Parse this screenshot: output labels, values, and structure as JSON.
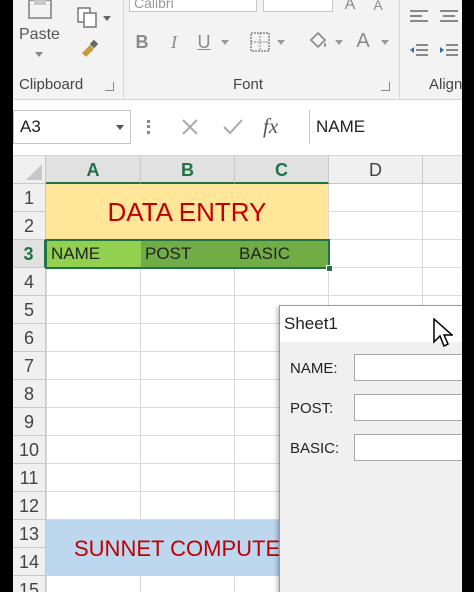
{
  "ribbon": {
    "clipboard": {
      "paste_label": "Paste",
      "group_label": "Clipboard"
    },
    "font": {
      "font_name": "Calibri",
      "group_label": "Font",
      "bold": "B",
      "italic": "I",
      "underline": "U",
      "font_color_glyph": "A"
    },
    "alignment": {
      "group_label": "Align"
    }
  },
  "formula_bar": {
    "name_box": "A3",
    "fx": "fx",
    "formula_value": "NAME"
  },
  "grid": {
    "columns": [
      "A",
      "B",
      "C",
      "D"
    ],
    "rows": [
      "1",
      "2",
      "3",
      "4",
      "5",
      "6",
      "7",
      "8",
      "9",
      "10",
      "11",
      "12",
      "13",
      "14",
      "15"
    ],
    "title": "DATA ENTRY",
    "headers": [
      "NAME",
      "POST",
      "BASIC"
    ],
    "banner": "SUNNET COMPUTE"
  },
  "userform": {
    "title": "Sheet1",
    "fields": [
      {
        "label": "NAME:",
        "value": ""
      },
      {
        "label": "POST:",
        "value": ""
      },
      {
        "label": "BASIC:",
        "value": ""
      }
    ]
  },
  "colors": {
    "title_fill": "#ffe699",
    "title_text": "#c00000",
    "header_fill_a": "#92d050",
    "header_fill_bc": "#70ad47",
    "banner_fill": "#bdd7ee",
    "banner_text": "#c00000",
    "excel_green": "#217346"
  }
}
